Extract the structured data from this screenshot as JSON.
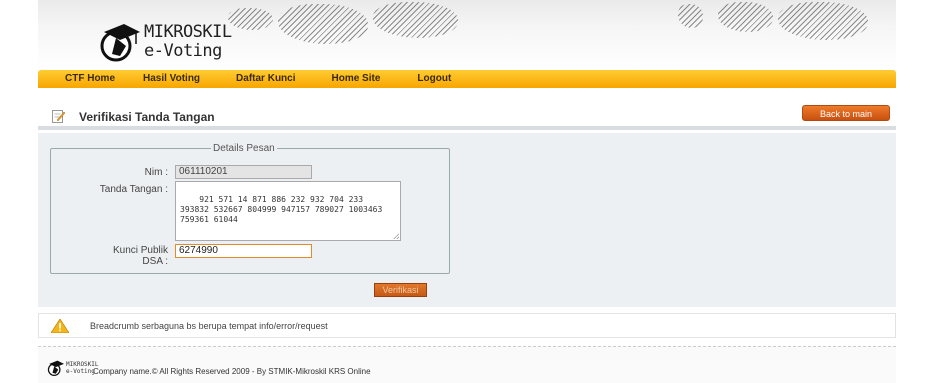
{
  "header": {
    "logo_line1": "MIKROSKIL",
    "logo_line2": "e-Voting"
  },
  "nav": {
    "items": [
      {
        "label": "CTF Home"
      },
      {
        "label": "Hasil Voting"
      },
      {
        "label": "Daftar Kunci"
      },
      {
        "label": "Home Site"
      },
      {
        "label": "Logout"
      }
    ]
  },
  "title_bar": {
    "title": "Verifikasi Tanda Tangan",
    "back_button": "Back to main"
  },
  "form": {
    "legend": "Details Pesan",
    "nim_label": "Nim :",
    "nim_value": "061110201",
    "ttd_label": "Tanda Tangan :",
    "ttd_value": "921 571 14 871 886 232 932 704 233 393832 532667 804999 947157 789027 1003463 759361 61044",
    "kunci_label_1": "Kunci Publik",
    "kunci_label_2": "DSA :",
    "kunci_value": "6274990",
    "submit_label": "Verifikasi"
  },
  "breadcrumb": {
    "text": "Breadcrumb serbaguna bs berupa tempat info/error/request"
  },
  "footer": {
    "logo_line1": "MIKROSKIL",
    "logo_line2": "e-Voting",
    "text": "Company name.© All Rights Reserved 2009 - By STMIK-Mikroskil KRS Online"
  },
  "colors": {
    "nav_bar": "#f7a600",
    "back_button": "#e06a22",
    "panel_bg": "#edf0f3"
  }
}
